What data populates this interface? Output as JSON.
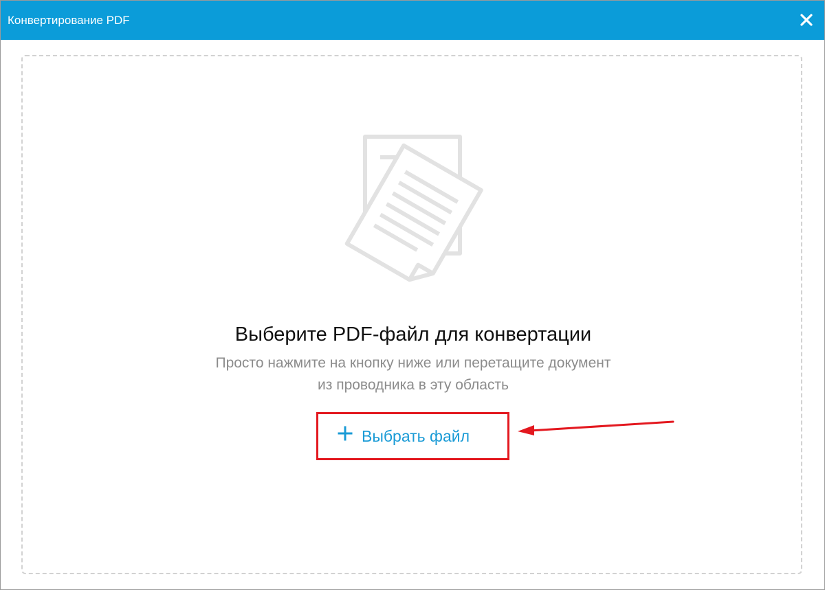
{
  "window": {
    "title": "Конвертирование PDF",
    "close_icon": "close-icon",
    "accent_color": "#0b9cd9"
  },
  "dropzone": {
    "illustration_icon": "documents-icon",
    "heading": "Выберите PDF-файл для конвертации",
    "hint_line1": "Просто нажмите на кнопку ниже или перетащите документ",
    "hint_line2": "из проводника в эту область",
    "choose_button": {
      "icon": "plus-icon",
      "label": "Выбрать файл",
      "highlight_color": "#e3181f"
    }
  },
  "annotation": {
    "arrow_icon": "arrow-left-icon",
    "color": "#e3181f"
  }
}
